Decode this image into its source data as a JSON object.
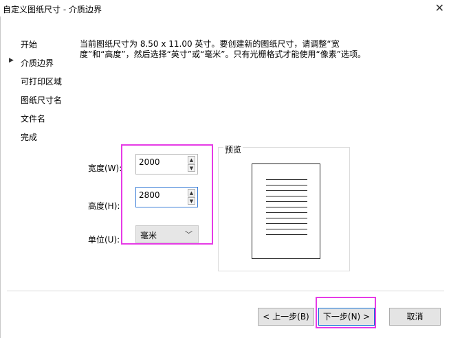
{
  "window": {
    "title": "自定义图纸尺寸 - 介质边界",
    "close_glyph": "✕"
  },
  "nav": {
    "current_marker": "▶",
    "items": [
      "开始",
      "介质边界",
      "可打印区域",
      "图纸尺寸名",
      "文件名",
      "完成"
    ],
    "current_index": 1
  },
  "description": "当前图纸尺寸为 8.50 x 11.00 英寸。要创建新的图纸尺寸，请调整“宽度”和“高度”，然后选择“英寸”或“毫米”。只有光栅格式才能使用“像素”选项。",
  "form": {
    "width_label": "宽度(W):",
    "width_value": "2000",
    "height_label": "高度(H):",
    "height_value": "2800",
    "unit_label": "单位(U):",
    "unit_value": "毫米"
  },
  "preview": {
    "label": "预览"
  },
  "buttons": {
    "back": "< 上一步(B)",
    "next": "下一步(N) >",
    "cancel": "取消"
  },
  "colors": {
    "highlight": "#e63be6",
    "focus_border": "#3c7fd8"
  }
}
